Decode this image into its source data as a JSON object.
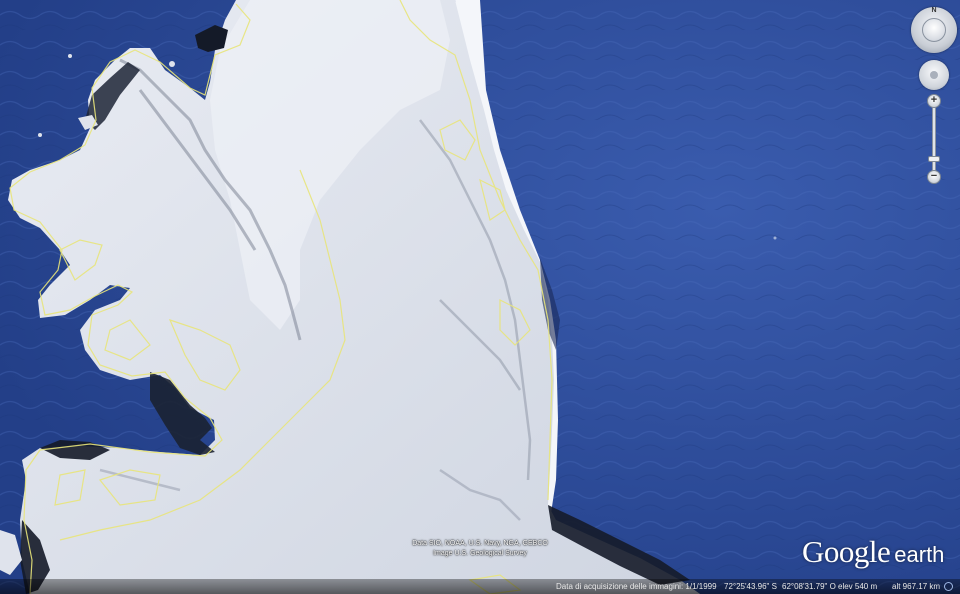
{
  "app": {
    "name": "Google Earth"
  },
  "map": {
    "water_color": "#2d4c98",
    "ice_color": "#dfe3ec",
    "coastline_color": "#e8e47a",
    "rock_color": "#1b2030"
  },
  "navigation": {
    "north_label": "N",
    "zoom_in_label": "+",
    "zoom_out_label": "−",
    "zoom_level": 0.85,
    "icons": [
      "compass-ring-icon",
      "look-joystick-icon",
      "zoom-slider-icon"
    ]
  },
  "attribution": {
    "line1": "Data SIO, NOAA, U.S. Navy, NGA, GEBCO",
    "line2": "Image U.S. Geological Survey"
  },
  "logo": {
    "google": "Google",
    "earth": "earth"
  },
  "status_bar": {
    "imagery_date": "Data di acquisizione delle immagini: 1/1/1999",
    "latitude": "72°25'43.96\" S",
    "longitude": "62°08'31.79\" O",
    "elevation": "elev   540 m",
    "eye_altitude": "alt 967.17 km"
  }
}
